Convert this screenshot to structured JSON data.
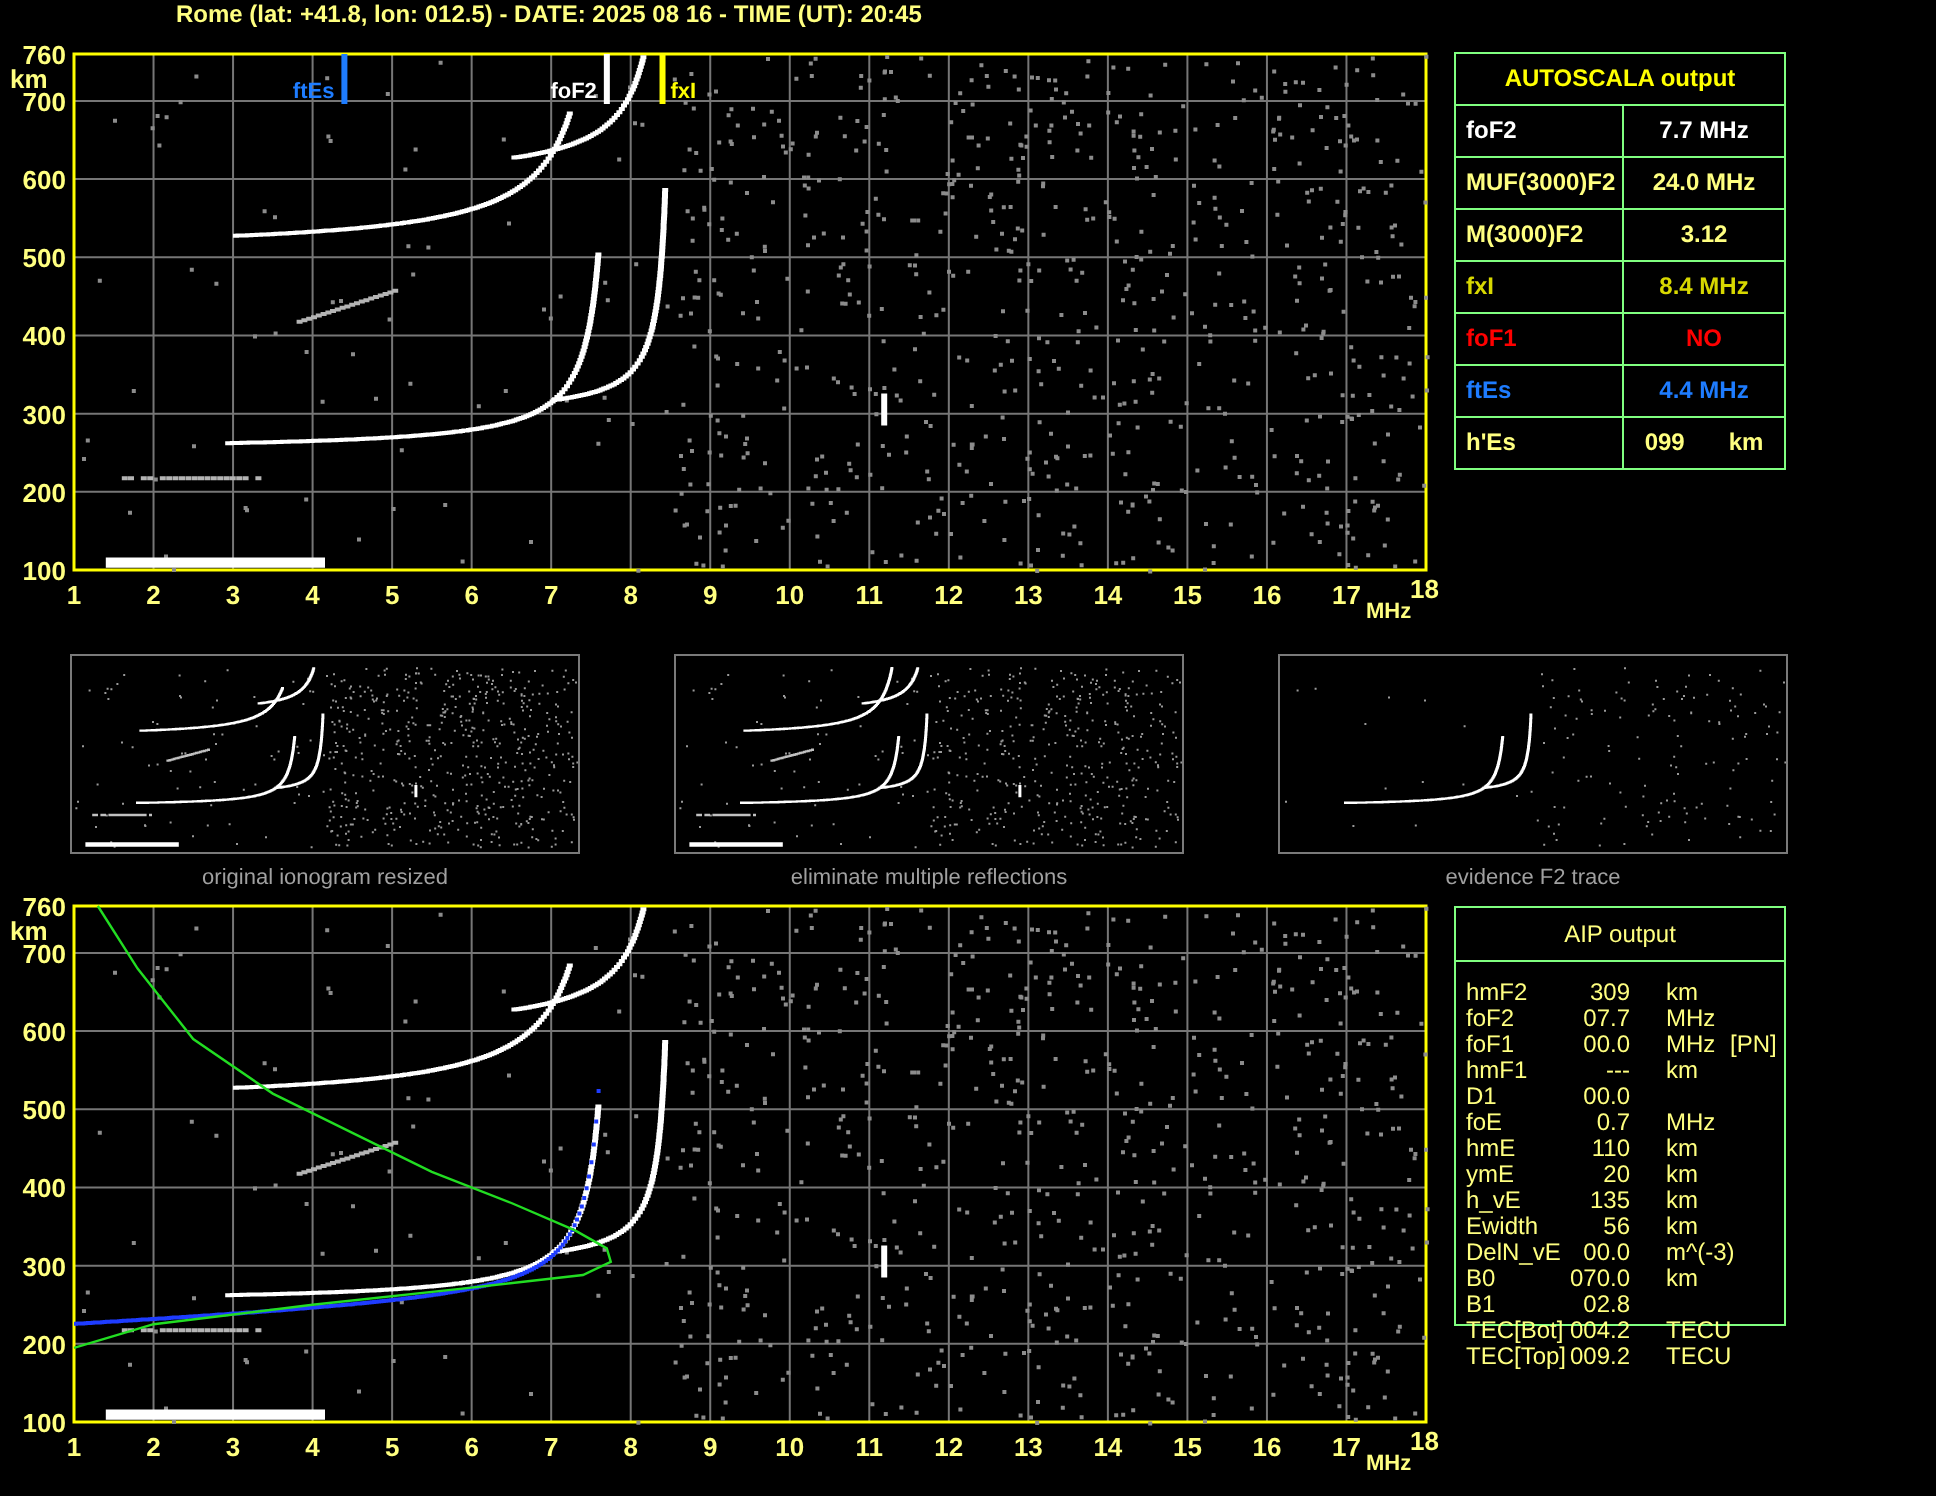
{
  "header": {
    "title": "Rome (lat: +41.8, lon: 012.5) - DATE: 2025 08 16 - TIME (UT): 20:45"
  },
  "ionogram_top": {
    "y_ticks": [
      "760",
      "700",
      "600",
      "500",
      "400",
      "300",
      "200",
      "100"
    ],
    "y_unit": "km",
    "x_ticks": [
      "1",
      "2",
      "3",
      "4",
      "5",
      "6",
      "7",
      "8",
      "9",
      "10",
      "11",
      "12",
      "13",
      "14",
      "15",
      "16",
      "17"
    ],
    "x_end": "18",
    "x_unit": "MHz",
    "markers": [
      {
        "label": "ftEs",
        "color": "#1e7cff"
      },
      {
        "label": "foF2",
        "color": "#ffffff"
      },
      {
        "label": "fxI",
        "color": "#ffff00"
      }
    ]
  },
  "autoscala": {
    "title": "AUTOSCALA output",
    "rows": [
      {
        "name": "foF2",
        "value": "7.7 MHz",
        "color": "#ffffff"
      },
      {
        "name": "MUF(3000)F2",
        "value": "24.0 MHz",
        "color": "#ffff80"
      },
      {
        "name": "M(3000)F2",
        "value": "3.12",
        "color": "#ffff80"
      },
      {
        "name": "fxI",
        "value": "8.4 MHz",
        "color": "#d8d800"
      },
      {
        "name": "foF1",
        "value": "NO",
        "color": "#ff0000"
      },
      {
        "name": "ftEs",
        "value": "4.4 MHz",
        "color": "#1e7cff"
      },
      {
        "name": "h'Es",
        "value": "099",
        "unit": "km",
        "color": "#ffff80"
      }
    ]
  },
  "thumbnails": [
    {
      "kind": "original",
      "caption": "original ionogram resized"
    },
    {
      "kind": "filtered",
      "caption": "eliminate multiple reflections"
    },
    {
      "kind": "f2_trace",
      "caption": "evidence F2 trace"
    }
  ],
  "ionogram_bottom": {
    "y_ticks": [
      "760",
      "700",
      "600",
      "500",
      "400",
      "300",
      "200",
      "100"
    ],
    "y_unit": "km",
    "x_ticks": [
      "1",
      "2",
      "3",
      "4",
      "5",
      "6",
      "7",
      "8",
      "9",
      "10",
      "11",
      "12",
      "13",
      "14",
      "15",
      "16",
      "17"
    ],
    "x_end": "18",
    "x_unit": "MHz"
  },
  "aip": {
    "title": "AIP output",
    "rows": [
      {
        "name": "hmF2",
        "value": "309",
        "unit": "km"
      },
      {
        "name": "foF2",
        "value": "07.7",
        "unit": "MHz"
      },
      {
        "name": "foF1",
        "value": "00.0",
        "unit": "MHz",
        "note": "[PN]"
      },
      {
        "name": "hmF1",
        "value": "---",
        "unit": "km"
      },
      {
        "name": "D1",
        "value": "00.0"
      },
      {
        "name": "foE",
        "value": "0.7",
        "unit": "MHz"
      },
      {
        "name": "hmE",
        "value": "110",
        "unit": "km"
      },
      {
        "name": "ymE",
        "value": "20",
        "unit": "km"
      },
      {
        "name": "h_vE",
        "value": "135",
        "unit": "km"
      },
      {
        "name": "Ewidth",
        "value": "56",
        "unit": "km"
      },
      {
        "name": "DelN_vE",
        "value": "00.0",
        "unit": "m^(-3)"
      },
      {
        "name": "B0",
        "value": "070.0",
        "unit": "km"
      },
      {
        "name": "B1",
        "value": "02.8"
      },
      {
        "name": "TEC[Bot]",
        "value": "004.2",
        "unit": "TECU"
      },
      {
        "name": "TEC[Top]",
        "value": "009.2",
        "unit": "TECU"
      }
    ]
  }
}
